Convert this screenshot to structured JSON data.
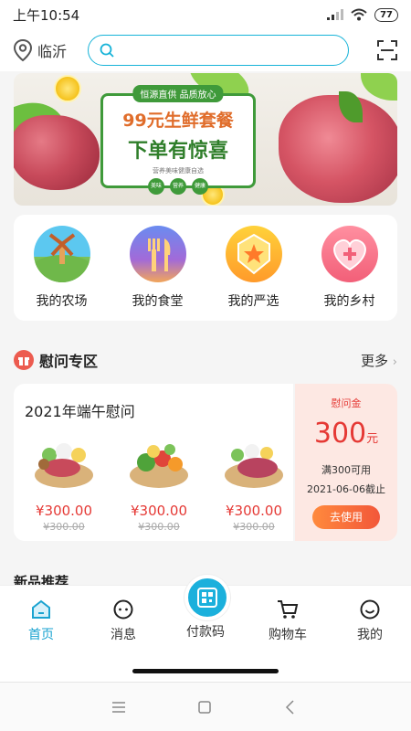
{
  "status_bar": {
    "time": "上午10:54",
    "battery": "77"
  },
  "header": {
    "location": "临沂",
    "search_placeholder": ""
  },
  "banner": {
    "top_tag": "恒源直供 品质放心",
    "headline": "99元生鲜套餐",
    "subline": "下单有惊喜",
    "small_text": "营养美味健康自选",
    "badges": [
      "美味",
      "营养",
      "健康"
    ]
  },
  "categories": [
    {
      "label": "我的农场",
      "icon": "farm-icon"
    },
    {
      "label": "我的食堂",
      "icon": "canteen-icon"
    },
    {
      "label": "我的严选",
      "icon": "selection-icon"
    },
    {
      "label": "我的乡村",
      "icon": "village-icon"
    }
  ],
  "section": {
    "title": "慰问专区",
    "more": "更多",
    "more_arrow": "›"
  },
  "card": {
    "title": "2021年端午慰问",
    "products": [
      {
        "price": "¥300.00",
        "old_price": "¥300.00"
      },
      {
        "price": "¥300.00",
        "old_price": "¥300.00"
      },
      {
        "price": "¥300.00",
        "old_price": "¥300.00"
      }
    ]
  },
  "coupon": {
    "title": "慰问金",
    "amount": "300",
    "unit": "元",
    "condition": "满300可用",
    "deadline": "2021-06-06截止",
    "button": "去使用"
  },
  "next_section": "新品推荐",
  "tabbar": {
    "tabs": [
      {
        "label": "首页",
        "icon": "home-icon",
        "active": true
      },
      {
        "label": "消息",
        "icon": "message-icon",
        "active": false
      },
      {
        "label": "付款码",
        "icon": "qr-code-icon",
        "active": false
      },
      {
        "label": "购物车",
        "icon": "cart-icon",
        "active": false
      },
      {
        "label": "我的",
        "icon": "profile-icon",
        "active": false
      }
    ]
  },
  "colors": {
    "accent": "#1aa3d0",
    "price_red": "#e53935",
    "coupon_bg": "#fde8e3"
  }
}
